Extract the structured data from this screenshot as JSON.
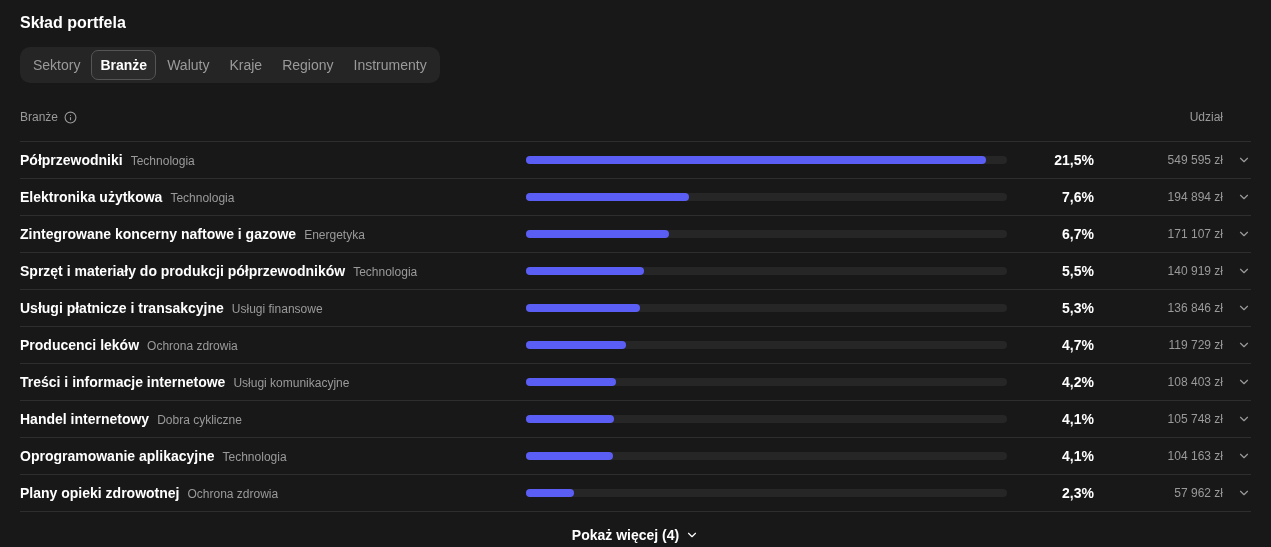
{
  "title": "Skład portfela",
  "tabs": [
    {
      "label": "Sektory",
      "selected": false
    },
    {
      "label": "Branże",
      "selected": true
    },
    {
      "label": "Waluty",
      "selected": false
    },
    {
      "label": "Kraje",
      "selected": false
    },
    {
      "label": "Regiony",
      "selected": false
    },
    {
      "label": "Instrumenty",
      "selected": false
    }
  ],
  "table": {
    "columns": [
      "Branże",
      "Udział"
    ],
    "rows": [
      {
        "name": "Półprzewodniki",
        "sector": "Technologia",
        "level": 0.956,
        "share": "21,5%",
        "value": "549 595 zł"
      },
      {
        "name": "Elektronika użytkowa",
        "sector": "Technologia",
        "level": 0.339,
        "share": "7,6%",
        "value": "194 894 zł"
      },
      {
        "name": "Zintegrowane koncerny naftowe i gazowe",
        "sector": "Energetyka",
        "level": 0.297,
        "share": "6,7%",
        "value": "171 107 zł"
      },
      {
        "name": "Sprzęt i materiały do produkcji półprzewodników",
        "sector": "Technologia",
        "level": 0.245,
        "share": "5,5%",
        "value": "140 919 zł"
      },
      {
        "name": "Usługi płatnicze i transakcyjne",
        "sector": "Usługi finansowe",
        "level": 0.237,
        "share": "5,3%",
        "value": "136 846 zł"
      },
      {
        "name": "Producenci leków",
        "sector": "Ochrona zdrowia",
        "level": 0.208,
        "share": "4,7%",
        "value": "119 729 zł"
      },
      {
        "name": "Treści i informacje internetowe",
        "sector": "Usługi komunikacyjne",
        "level": 0.187,
        "share": "4,2%",
        "value": "108 403 zł"
      },
      {
        "name": "Handel internetowy",
        "sector": "Dobra cykliczne",
        "level": 0.183,
        "share": "4,1%",
        "value": "105 748 zł"
      },
      {
        "name": "Oprogramowanie aplikacyjne",
        "sector": "Technologia",
        "level": 0.181,
        "share": "4,1%",
        "value": "104 163 zł"
      },
      {
        "name": "Plany opieki zdrowotnej",
        "sector": "Ochrona zdrowia",
        "level": 0.1,
        "share": "2,3%",
        "value": "57 962 zł"
      }
    ]
  },
  "show_more": "Pokaż więcej (4)"
}
